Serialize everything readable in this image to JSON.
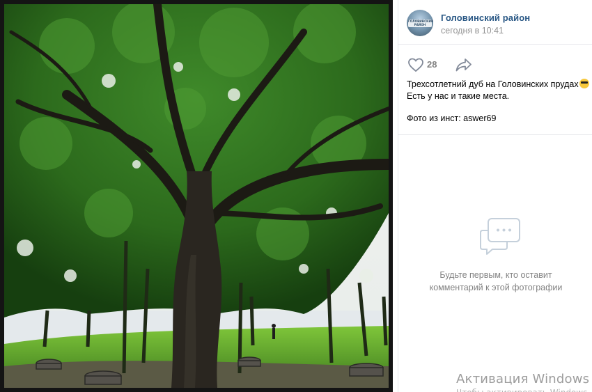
{
  "post": {
    "group_name": "Головинский район",
    "time": "сегодня в 10:41",
    "avatar_text": "ГОЛОВИНСКИЙ РАЙОН",
    "likes_count": "28",
    "caption_line1": "Трехсотлетний дуб на Головинских прудах",
    "caption_line2": "Есть у нас и такие места.",
    "caption_line3": "Фото из инст: aswer69"
  },
  "comments": {
    "empty_line1": "Будьте первым, кто оставит",
    "empty_line2": "комментарий к этой фотографии"
  },
  "windows": {
    "activation_title": "Активация Windows",
    "activation_sub": "Чтобы активировать Windows"
  },
  "icons": {
    "like": "heart-outline-icon",
    "share": "share-arrow-icon",
    "comments_empty": "speech-bubbles-icon",
    "emoji": "sunglasses-emoji"
  },
  "colors": {
    "link": "#2a5885",
    "muted": "#828282",
    "photo_bg": "#141414"
  }
}
